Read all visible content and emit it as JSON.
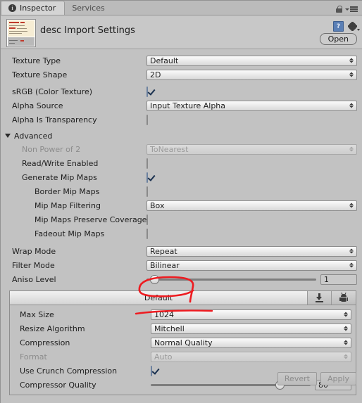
{
  "window": {
    "tabs": [
      {
        "label": "Inspector",
        "icon": "info-icon",
        "active": true
      },
      {
        "label": "Services",
        "icon": "",
        "active": false
      }
    ],
    "lock_icon": "lock-icon",
    "menu_icon": "hamburger-menu-icon"
  },
  "header": {
    "title": "desc Import Settings",
    "thumbnail": "texture-thumbnail",
    "help_icon": "help-book-icon",
    "gear_icon": "gear-icon",
    "open_button": "Open"
  },
  "main": {
    "rows": [
      {
        "label": "Texture Type",
        "type": "dropdown",
        "value": "Default",
        "indent": 0,
        "disabled": false
      },
      {
        "label": "Texture Shape",
        "type": "dropdown",
        "value": "2D",
        "indent": 0,
        "disabled": false
      },
      {
        "label": "sRGB (Color Texture)",
        "type": "checkbox",
        "checked": true,
        "indent": 0,
        "disabled": false
      },
      {
        "label": "Alpha Source",
        "type": "dropdown",
        "value": "Input Texture Alpha",
        "indent": 0,
        "disabled": false
      },
      {
        "label": "Alpha Is Transparency",
        "type": "checkbox",
        "checked": false,
        "indent": 0,
        "disabled": false
      }
    ],
    "advanced": {
      "label": "Advanced",
      "expanded": true,
      "rows": [
        {
          "label": "Non Power of 2",
          "type": "dropdown",
          "value": "ToNearest",
          "indent": 1,
          "disabled": true
        },
        {
          "label": "Read/Write Enabled",
          "type": "checkbox",
          "checked": false,
          "indent": 1,
          "disabled": false
        },
        {
          "label": "Generate Mip Maps",
          "type": "checkbox",
          "checked": true,
          "indent": 1,
          "disabled": false
        },
        {
          "label": "Border Mip Maps",
          "type": "checkbox",
          "checked": false,
          "indent": 2,
          "disabled": false
        },
        {
          "label": "Mip Map Filtering",
          "type": "dropdown",
          "value": "Box",
          "indent": 2,
          "disabled": false
        },
        {
          "label": "Mip Maps Preserve Coverage",
          "type": "checkbox",
          "checked": false,
          "indent": 2,
          "disabled": false
        },
        {
          "label": "Fadeout Mip Maps",
          "type": "checkbox",
          "checked": false,
          "indent": 2,
          "disabled": false
        }
      ]
    },
    "filter_rows": [
      {
        "label": "Wrap Mode",
        "type": "dropdown",
        "value": "Repeat",
        "indent": 0,
        "disabled": false
      },
      {
        "label": "Filter Mode",
        "type": "dropdown",
        "value": "Bilinear",
        "indent": 0,
        "disabled": false
      },
      {
        "label": "Aniso Level",
        "type": "slider",
        "value": "1",
        "percent": 2,
        "indent": 0,
        "disabled": false
      }
    ]
  },
  "platform": {
    "tabs": [
      {
        "label": "Default",
        "icon": "",
        "active": true
      },
      {
        "label": "",
        "icon": "standalone-icon",
        "active": false
      },
      {
        "label": "",
        "icon": "android-icon",
        "active": false
      }
    ],
    "rows": [
      {
        "label": "Max Size",
        "type": "dropdown",
        "value": "1024",
        "disabled": false
      },
      {
        "label": "Resize Algorithm",
        "type": "dropdown",
        "value": "Mitchell",
        "disabled": false
      },
      {
        "label": "Compression",
        "type": "dropdown",
        "value": "Normal Quality",
        "disabled": false
      },
      {
        "label": "Format",
        "type": "dropdown",
        "value": "Auto",
        "disabled": true
      },
      {
        "label": "Use Crunch Compression",
        "type": "checkbox",
        "checked": true,
        "disabled": false
      },
      {
        "label": "Compressor Quality",
        "type": "slider",
        "value": "80",
        "percent": 80,
        "disabled": false
      }
    ]
  },
  "footer": {
    "revert_button": "Revert",
    "apply_button": "Apply"
  },
  "annotations": {
    "color": "#ee1b20",
    "marks": [
      {
        "name": "circle-around-default-tab"
      },
      {
        "name": "underline-below-max-size"
      }
    ]
  }
}
